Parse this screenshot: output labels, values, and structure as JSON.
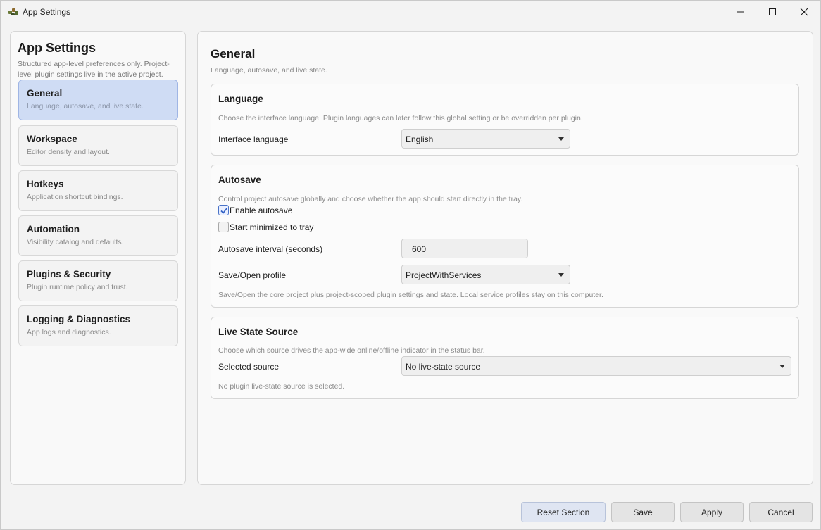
{
  "window": {
    "title": "App Settings"
  },
  "sidebar": {
    "title": "App Settings",
    "description": "Structured app-level preferences only. Project-level plugin settings live in the active project.",
    "items": [
      {
        "label": "General",
        "sub": "Language, autosave, and live state.",
        "active": true
      },
      {
        "label": "Workspace",
        "sub": "Editor density and layout.",
        "active": false
      },
      {
        "label": "Hotkeys",
        "sub": "Application shortcut bindings.",
        "active": false
      },
      {
        "label": "Automation",
        "sub": "Visibility catalog and defaults.",
        "active": false
      },
      {
        "label": "Plugins & Security",
        "sub": "Plugin runtime policy and trust.",
        "active": false
      },
      {
        "label": "Logging & Diagnostics",
        "sub": "App logs and diagnostics.",
        "active": false
      }
    ]
  },
  "main": {
    "title": "General",
    "subtitle": "Language, autosave, and live state.",
    "language": {
      "title": "Language",
      "description": "Choose the interface language. Plugin languages can later follow this global setting or be overridden per plugin.",
      "field_label": "Interface language",
      "value": "English"
    },
    "autosave": {
      "title": "Autosave",
      "description": "Control project autosave globally and choose whether the app should start directly in the tray.",
      "enable_label": "Enable autosave",
      "enable_checked": true,
      "tray_label": "Start minimized to tray",
      "tray_checked": false,
      "interval_label": "Autosave interval (seconds)",
      "interval_value": "600",
      "profile_label": "Save/Open profile",
      "profile_value": "ProjectWithServices",
      "profile_note": "Save/Open the core project plus project-scoped plugin settings and state. Local service profiles stay on this computer."
    },
    "live_state": {
      "title": "Live State Source",
      "description": "Choose which source drives the app-wide online/offline indicator in the status bar.",
      "field_label": "Selected source",
      "value": "No live-state source",
      "note": "No plugin live-state source is selected."
    }
  },
  "footer": {
    "reset_label": "Reset Section",
    "save_label": "Save",
    "apply_label": "Apply",
    "cancel_label": "Cancel"
  },
  "colors": {
    "active_nav_bg": "#cfdcf4",
    "active_nav_border": "#9fb5e4",
    "checkbox_accent": "#4a73c8"
  }
}
